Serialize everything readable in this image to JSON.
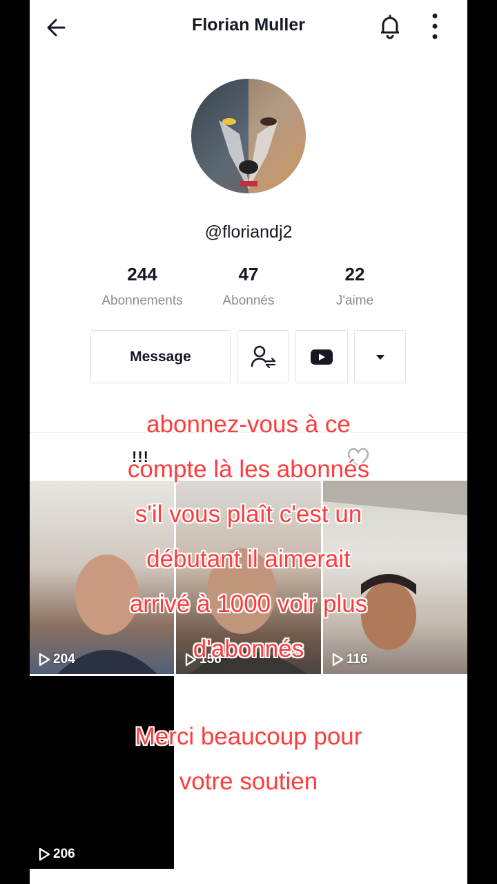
{
  "header": {
    "title": "Florian Muller"
  },
  "profile": {
    "handle": "@floriandj2"
  },
  "stats": [
    {
      "value": "244",
      "label": "Abonnements"
    },
    {
      "value": "47",
      "label": "Abonnés"
    },
    {
      "value": "22",
      "label": "J'aime"
    }
  ],
  "actions": {
    "message_label": "Message"
  },
  "tabs": {
    "grid_label": "!!!"
  },
  "videos": [
    {
      "views": "204"
    },
    {
      "views": "156"
    },
    {
      "views": "116"
    },
    {
      "views": "206"
    }
  ],
  "overlay": {
    "caption_lines": [
      "abonnez-vous à ce",
      "compte là les abonnés",
      "s'il vous plaît c'est un",
      "débutant il aimerait",
      "arrivé à 1000 voir plus",
      "d'abonnés"
    ],
    "thanks_lines": [
      "Merci beaucoup pour",
      "votre soutien"
    ]
  },
  "colors": {
    "overlay_text": "#ff3b3b",
    "primary_text": "#161823",
    "secondary_text": "#8a8b91"
  }
}
